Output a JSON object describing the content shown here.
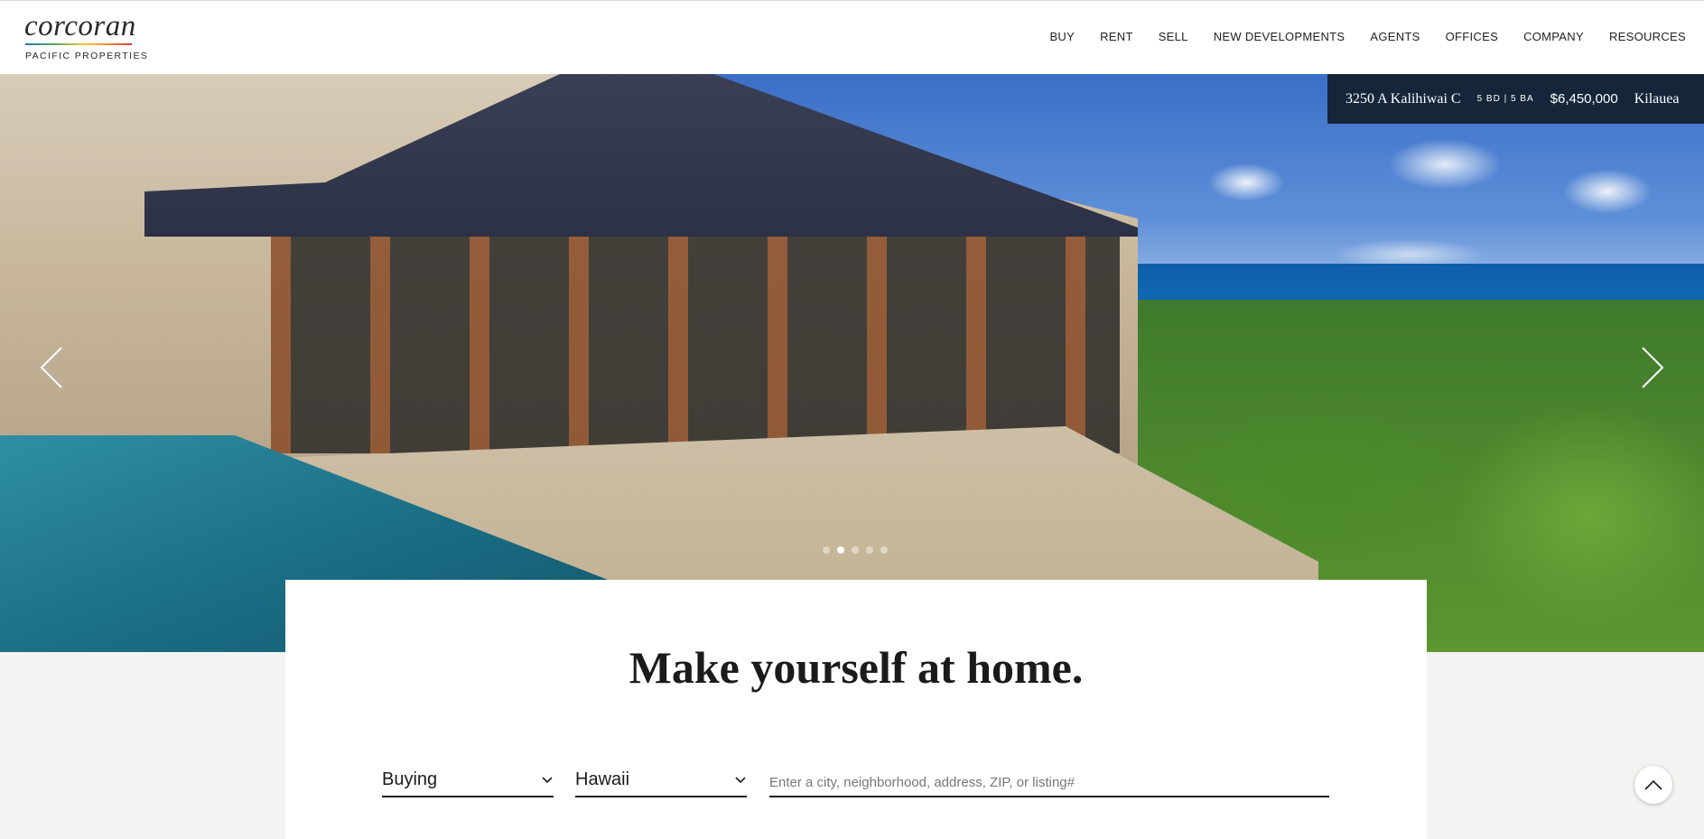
{
  "brand": {
    "name": "corcoran",
    "subtitle": "PACIFIC PROPERTIES"
  },
  "nav": {
    "items": [
      "BUY",
      "RENT",
      "SELL",
      "NEW DEVELOPMENTS",
      "AGENTS",
      "OFFICES",
      "COMPANY",
      "RESOURCES"
    ]
  },
  "hero": {
    "listing": {
      "address": "3250 A Kalihiwai C",
      "beds_baths": "5 BD | 5 BA",
      "price": "$6,450,000",
      "city": "Kilauea"
    },
    "slide_count": 5,
    "active_slide": 2,
    "prev_icon": "chevron-left-icon",
    "next_icon": "chevron-right-icon"
  },
  "search": {
    "headline": "Make yourself at home.",
    "mode": {
      "selected": "Buying"
    },
    "region": {
      "selected": "Hawaii"
    },
    "placeholder": "Enter a city, neighborhood, address, ZIP, or listing#"
  },
  "colors": {
    "listing_tag_bg": "#15263a",
    "page_bg": "#f3f3f2"
  }
}
